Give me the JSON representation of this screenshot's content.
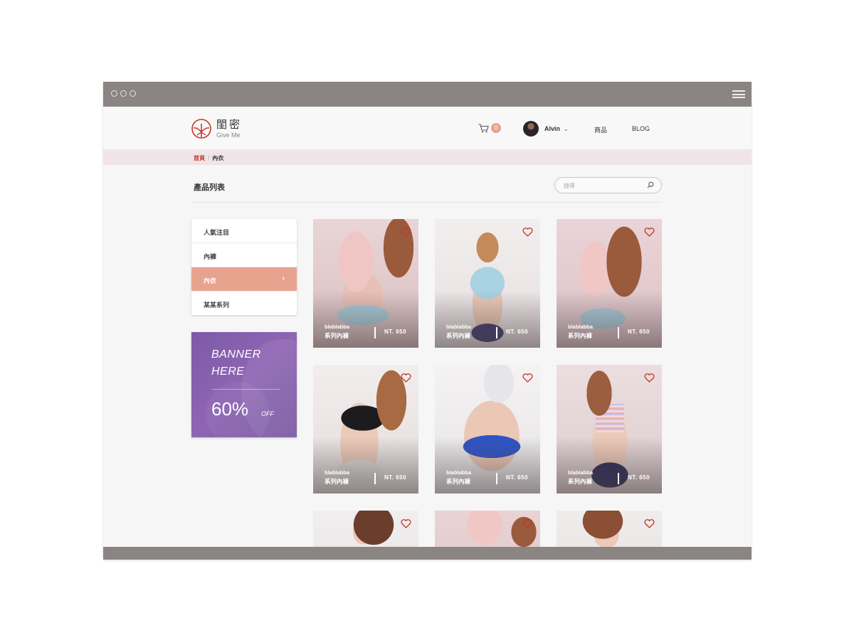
{
  "header": {
    "logo_cn": "閨密",
    "logo_en": "Give Me",
    "cart_count": "0",
    "user_name": "Alvin",
    "nav": [
      "商品",
      "BLOG"
    ]
  },
  "breadcrumb": {
    "home": "首頁",
    "separator": "/",
    "current": "內衣"
  },
  "page": {
    "title": "產品列表",
    "search_placeholder": "搜尋"
  },
  "sidebar": {
    "categories": [
      {
        "label": "人氣注目",
        "active": false
      },
      {
        "label": "內褲",
        "active": false
      },
      {
        "label": "內衣",
        "active": true
      },
      {
        "label": "某某系列",
        "active": false
      }
    ],
    "active_arrow": "›"
  },
  "banner": {
    "title": "BANNER HERE",
    "percent": "60%",
    "off": "OFF"
  },
  "products": [
    {
      "name": "blablabba",
      "series": "系列內褲",
      "price": "NT. 650"
    },
    {
      "name": "blablabba",
      "series": "系列內褲",
      "price": "NT. 650"
    },
    {
      "name": "blablabba",
      "series": "系列內褲",
      "price": "NT. 650"
    },
    {
      "name": "blablabba",
      "series": "系列內褲",
      "price": "NT. 650"
    },
    {
      "name": "blablabba",
      "series": "系列內褲",
      "price": "NT. 650"
    },
    {
      "name": "blablabba",
      "series": "系列內褲",
      "price": "NT. 650"
    }
  ],
  "colors": {
    "accent": "#e8a38f",
    "frame": "#8a8483",
    "breadcrumb_bg": "#f1e4e7",
    "banner": "#8a62b0",
    "heart": "#c0392b"
  }
}
